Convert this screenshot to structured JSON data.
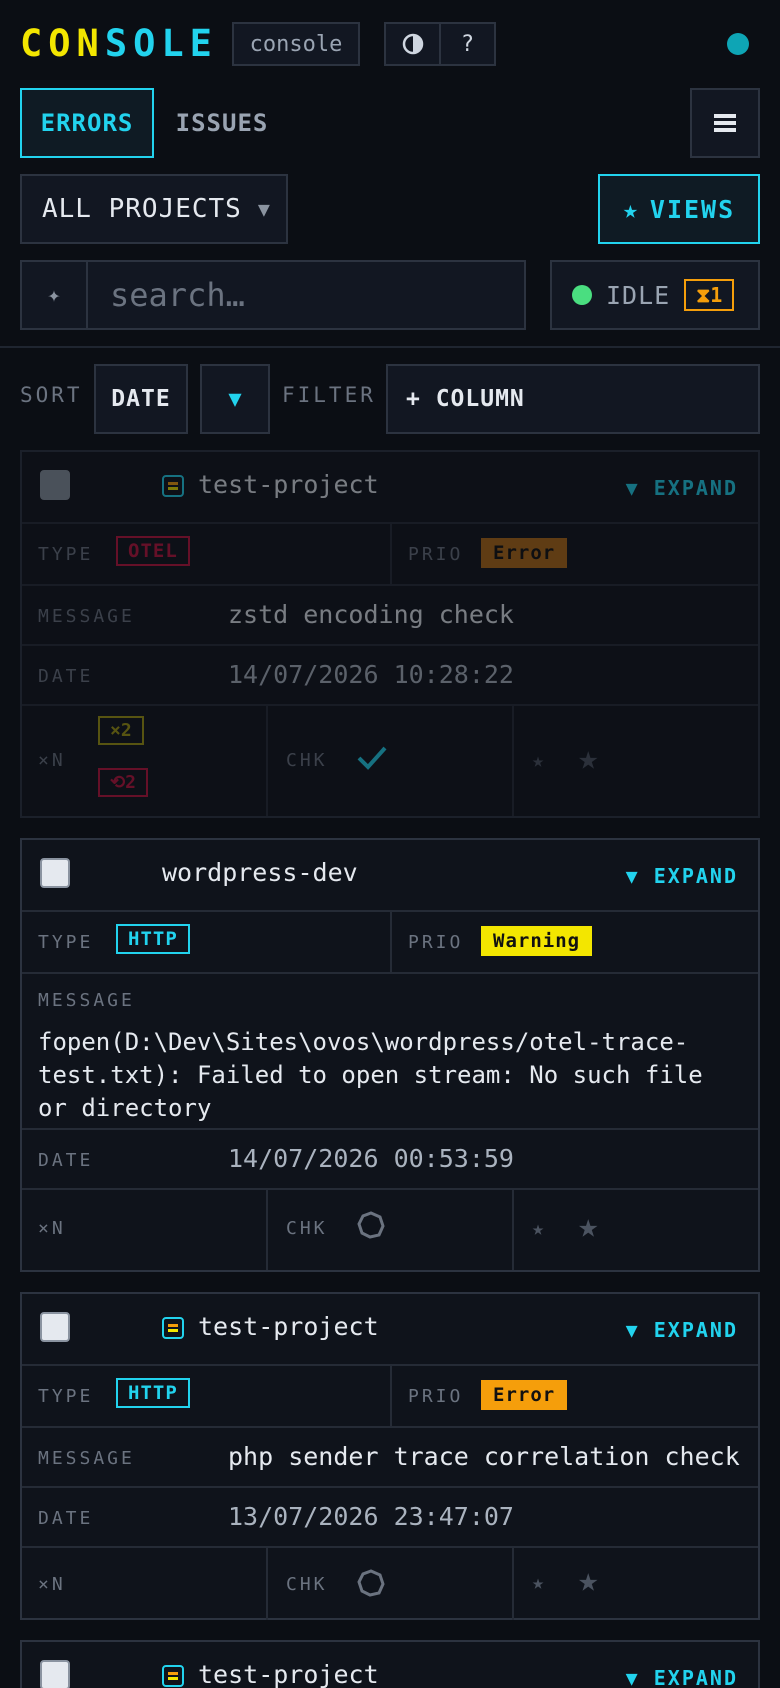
{
  "header": {
    "logo_part1": "CON",
    "logo_part2": "SOLE",
    "console_label": "console",
    "contrast_icon": "contrast-icon",
    "help_label": "?",
    "status_color": "#0ea5b5"
  },
  "tabs": [
    {
      "label": "ERRORS",
      "active": true
    },
    {
      "label": "ISSUES",
      "active": false
    }
  ],
  "project_select": {
    "value": "ALL PROJECTS"
  },
  "views_button": {
    "label": "VIEWS"
  },
  "search": {
    "placeholder": "search…"
  },
  "status": {
    "label": "IDLE",
    "badge": "⧗1"
  },
  "sort": {
    "label": "SORT",
    "field": "DATE",
    "direction": "▼",
    "filter_label": "FILTER",
    "add_column": "+ COLUMN"
  },
  "labels": {
    "type": "TYPE",
    "prio": "PRIO",
    "message": "MESSAGE",
    "date": "DATE",
    "count": "×N",
    "chk": "CHK",
    "expand": "EXPAND"
  },
  "cards": [
    {
      "project": "test-project",
      "type": "OTEL",
      "prio": "Error",
      "message": "zstd encoding check",
      "date": "14/07/2026 10:28:22",
      "count_badge": "×2",
      "retry_badge": "⟲2",
      "checked": true
    },
    {
      "project": "wordpress-dev",
      "type": "HTTP",
      "prio": "Warning",
      "message": "fopen(D:\\Dev\\Sites\\ovos\\wordpress/otel-trace-test.txt): Failed to open stream: No such file or directory",
      "date": "14/07/2026 00:53:59",
      "checked": false
    },
    {
      "project": "test-project",
      "type": "HTTP",
      "prio": "Error",
      "message": "php sender trace correlation check",
      "date": "13/07/2026 23:47:07",
      "checked": false
    },
    {
      "project": "test-project"
    }
  ],
  "colors": {
    "accent": "#22d3ee",
    "yellow": "#f3e600",
    "orange": "#f59e0b",
    "red": "#be123c"
  }
}
